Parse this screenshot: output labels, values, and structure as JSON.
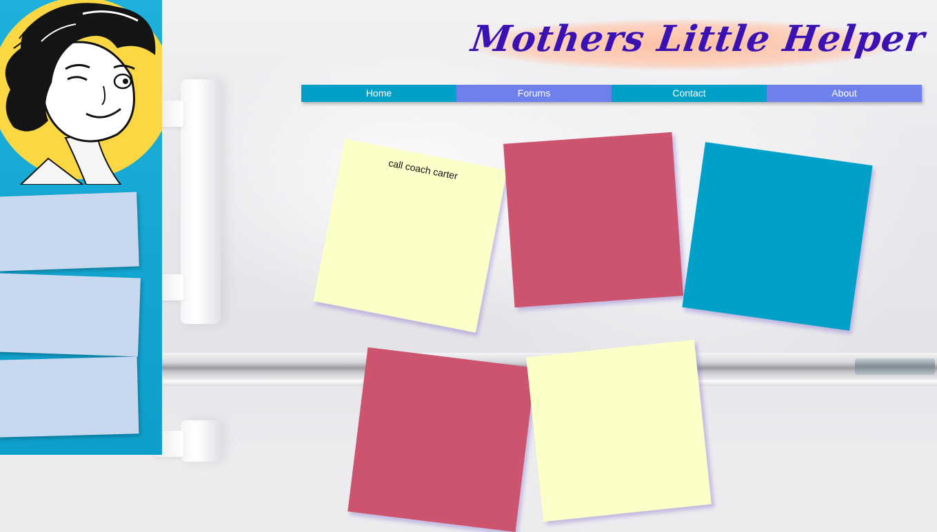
{
  "site": {
    "title": "Mothers Little Helper"
  },
  "nav": {
    "items": [
      {
        "label": "Home",
        "color": "#00a0c8"
      },
      {
        "label": "Forums",
        "color": "#6e80ec"
      },
      {
        "label": "Contact",
        "color": "#00a0c8"
      },
      {
        "label": "About",
        "color": "#6e80ec"
      }
    ]
  },
  "notes": [
    {
      "text": "call coach carter",
      "color": "#fbffc8"
    },
    {
      "text": "",
      "color": "#cc546e"
    },
    {
      "text": "",
      "color": "#00a0c8"
    },
    {
      "text": "",
      "color": "#cc546e"
    },
    {
      "text": "",
      "color": "#fbffc8"
    }
  ],
  "sidebar": {
    "notes_color": "#c8d9ef",
    "portrait_icon": "winking-woman-illustration"
  }
}
